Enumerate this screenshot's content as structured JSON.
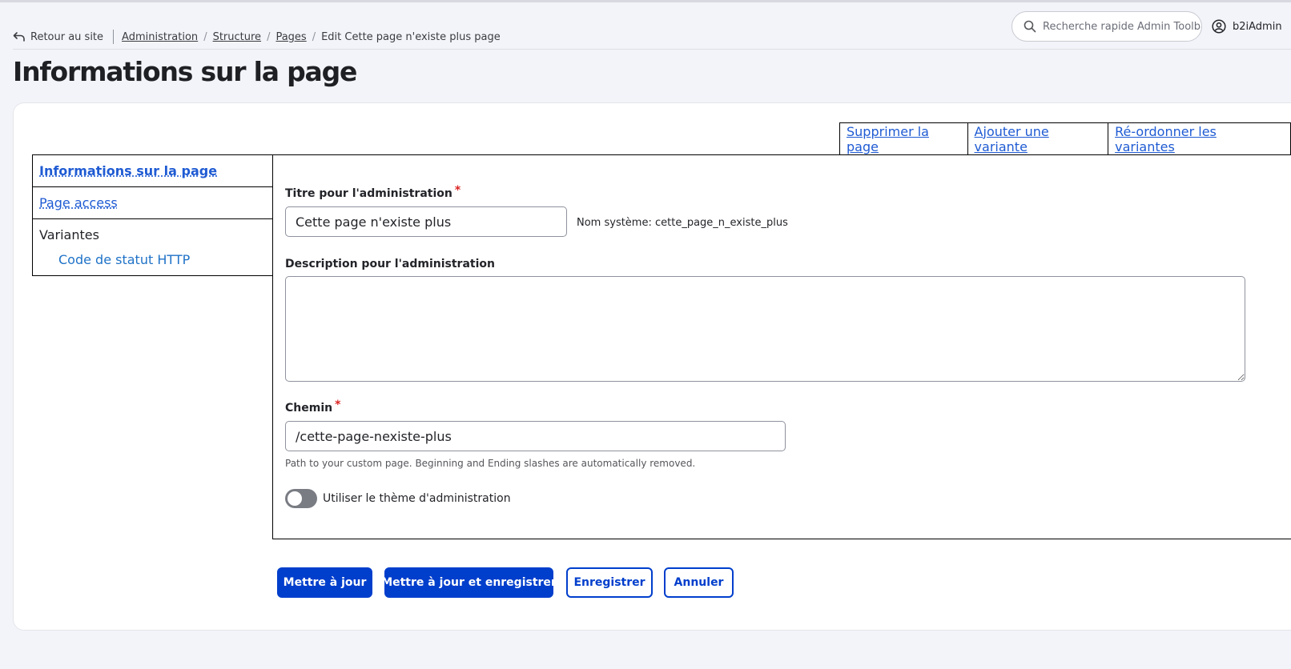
{
  "breadcrumb": {
    "back_label": "Retour au site",
    "items": [
      "Administration",
      "Structure",
      "Pages",
      "Edit Cette page n'existe plus page"
    ]
  },
  "search": {
    "placeholder": "Recherche rapide Admin Toolbar"
  },
  "user": {
    "name": "b2iAdmin"
  },
  "page_title": "Informations sur la page",
  "operations": [
    "Supprimer la page",
    "Ajouter une variante",
    "Ré-ordonner les variantes"
  ],
  "vtabs": {
    "items": [
      "Informations sur la page",
      "Page access"
    ],
    "group_label": "Variantes",
    "sub_item": "Code de statut HTTP"
  },
  "form": {
    "admin_title_label": "Titre pour l'administration",
    "admin_title_value": "Cette page n'existe plus",
    "machine_name": "Nom système: cette_page_n_existe_plus",
    "description_label": "Description pour l'administration",
    "description_value": "",
    "path_label": "Chemin",
    "path_value": "/cette-page-nexiste-plus",
    "path_help": "Path to your custom page. Beginning and Ending slashes are automatically removed.",
    "admin_theme_label": "Utiliser le thème d'administration",
    "admin_theme_on": false,
    "required_mark": "*"
  },
  "actions": {
    "update": "Mettre à jour",
    "update_save": "Mettre à jour et enregistrer",
    "save": "Enregistrer",
    "cancel": "Annuler"
  },
  "colors": {
    "primary": "#003ecc",
    "link": "#1f5bd3",
    "required": "#dc2323",
    "background": "#f3f4f9"
  }
}
